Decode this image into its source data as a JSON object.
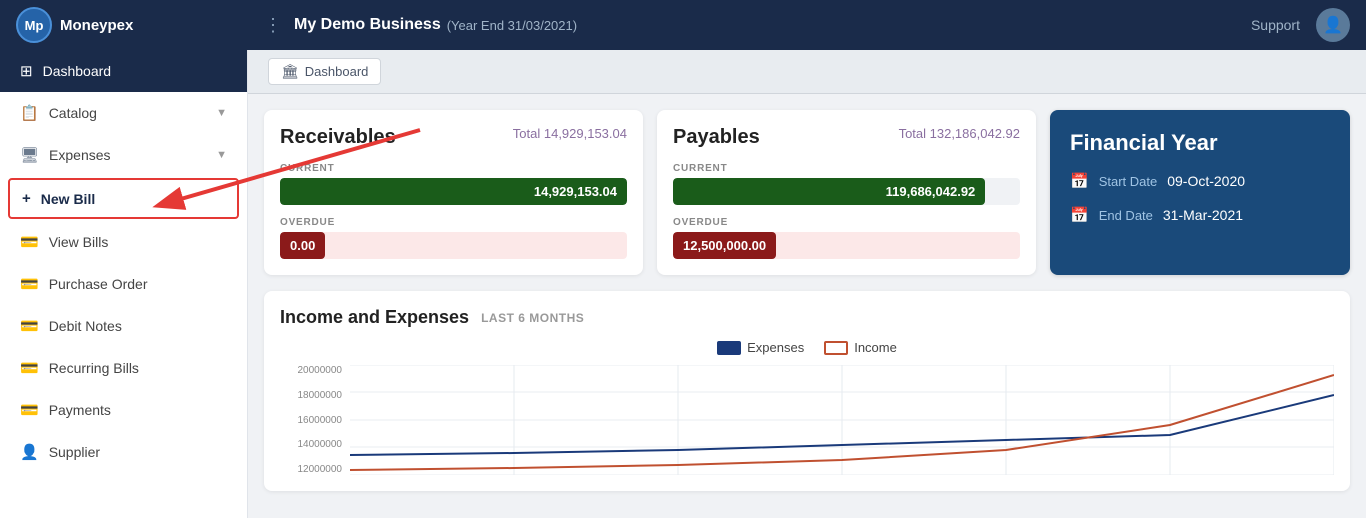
{
  "header": {
    "logo_initials": "Mp",
    "logo_name": "Moneypex",
    "dots_icon": "⋮",
    "business_name": "My Demo Business",
    "year_label": "(Year End 31/03/2021)",
    "support_label": "Support"
  },
  "sidebar": {
    "items": [
      {
        "id": "dashboard",
        "label": "Dashboard",
        "icon": "⊞",
        "active": true
      },
      {
        "id": "catalog",
        "label": "Catalog",
        "icon": "🗒",
        "has_arrow": true
      },
      {
        "id": "expenses",
        "label": "Expenses",
        "icon": "🖥",
        "has_arrow": true
      },
      {
        "id": "new-bill",
        "label": "New Bill",
        "icon": "+",
        "highlight": true
      },
      {
        "id": "view-bills",
        "label": "View Bills",
        "icon": "💳"
      },
      {
        "id": "purchase-order",
        "label": "Purchase Order",
        "icon": "💳"
      },
      {
        "id": "debit-notes",
        "label": "Debit Notes",
        "icon": "💳"
      },
      {
        "id": "recurring-bills",
        "label": "Recurring Bills",
        "icon": "💳"
      },
      {
        "id": "payments",
        "label": "Payments",
        "icon": "💳"
      },
      {
        "id": "supplier",
        "label": "Supplier",
        "icon": "👤"
      }
    ]
  },
  "breadcrumb": {
    "icon": "🏛",
    "label": "Dashboard"
  },
  "receivables": {
    "title": "Receivables",
    "total_label": "Total 14,929,153.04",
    "current_label": "CURRENT",
    "current_value": "14,929,153.04",
    "overdue_label": "OVERDUE",
    "overdue_value": "0.00"
  },
  "payables": {
    "title": "Payables",
    "total_label": "Total 132,186,042.92",
    "current_label": "CURRENT",
    "current_value": "119,686,042.92",
    "overdue_label": "OVERDUE",
    "overdue_value": "12,500,000.00"
  },
  "financial_year": {
    "title": "Financial Year",
    "start_label": "Start Date",
    "start_value": "09-Oct-2020",
    "end_label": "End Date",
    "end_value": "31-Mar-2021"
  },
  "income_expenses": {
    "title": "Income and Expenses",
    "period": "LAST 6 MONTHS",
    "legend": [
      {
        "label": "Expenses",
        "color": "#1a3a7a"
      },
      {
        "label": "Income",
        "color": "#c0502a"
      }
    ],
    "y_labels": [
      "20000000",
      "18000000",
      "16000000",
      "14000000",
      "12000000"
    ],
    "colors": {
      "expenses_line": "#1a3a7a",
      "income_line": "#c05030"
    }
  }
}
